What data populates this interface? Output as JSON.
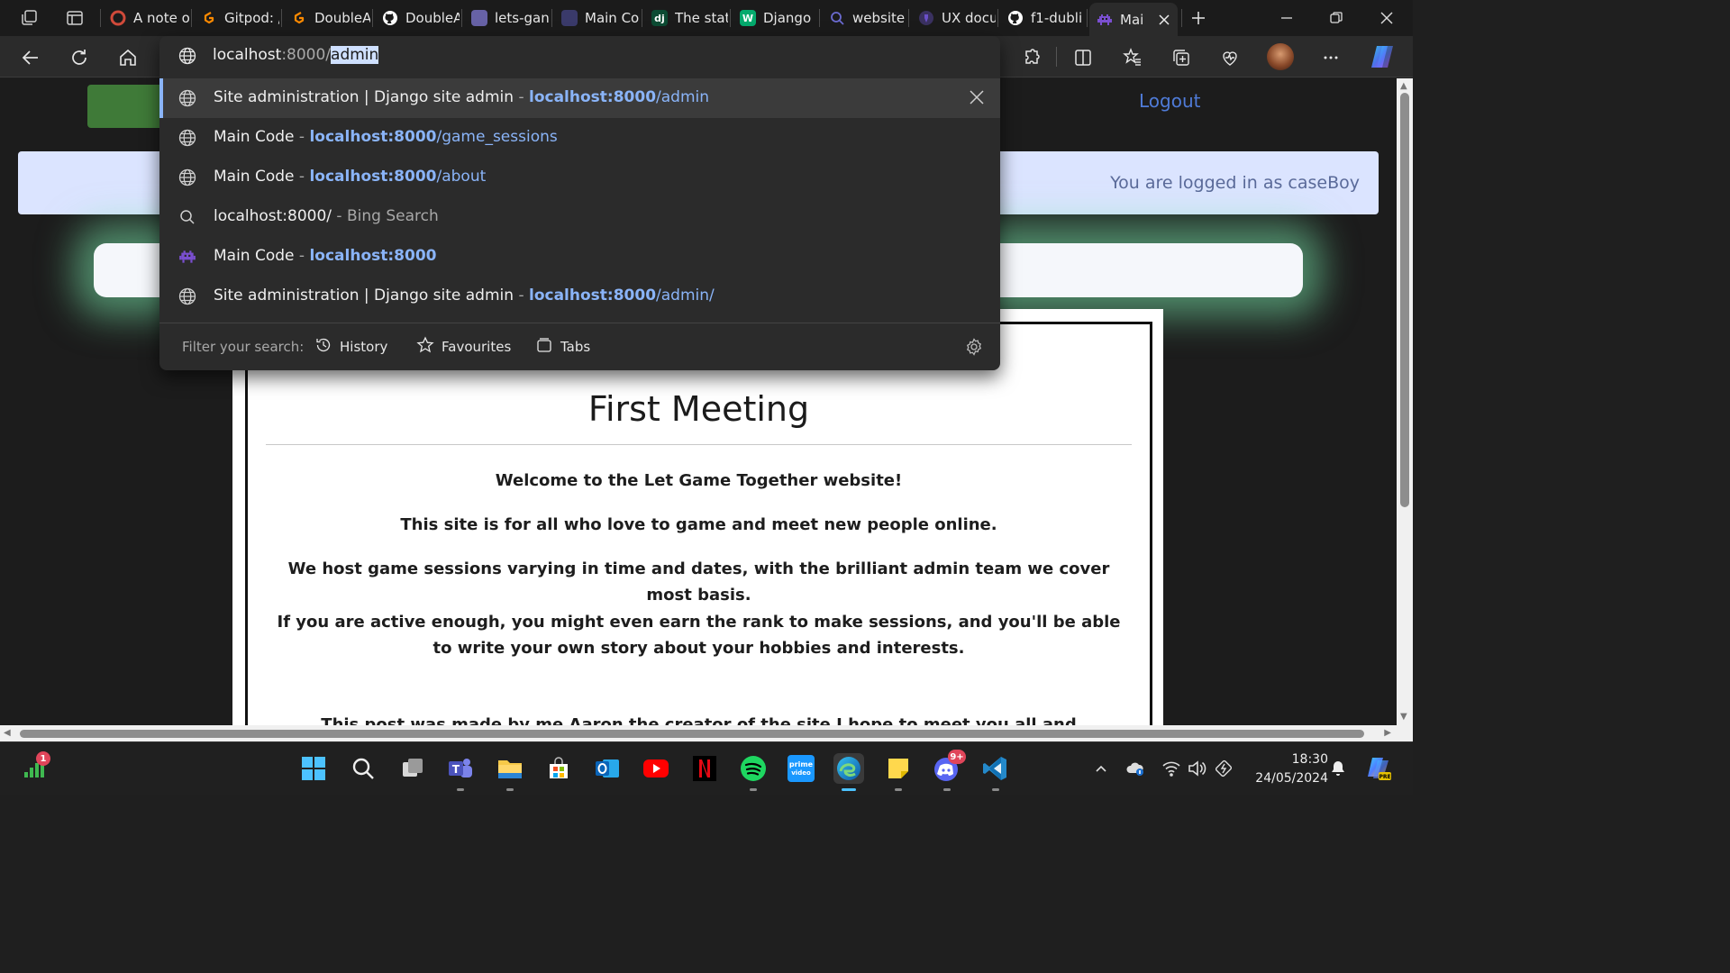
{
  "tabs": [
    {
      "title": "A note o",
      "favicon": "opera-icon",
      "color": "#d04a3a"
    },
    {
      "title": "Gitpod: /",
      "favicon": "gitpod-icon",
      "color": "#ff8a00"
    },
    {
      "title": "DoubleA",
      "favicon": "gitpod-icon",
      "color": "#ff8a00"
    },
    {
      "title": "DoubleA",
      "favicon": "github-icon",
      "color": "#ffffff"
    },
    {
      "title": "lets-gan",
      "favicon": "heroku-icon",
      "color": "#6762a6"
    },
    {
      "title": "Main Co",
      "favicon": "page-icon",
      "color": "#3a3a6a"
    },
    {
      "title": "The stat",
      "favicon": "django-icon",
      "letter": "dj",
      "color": "#0c4b33"
    },
    {
      "title": "Django",
      "favicon": "w3-icon",
      "letter": "W",
      "color": "#04aa6d"
    },
    {
      "title": "website",
      "favicon": "search-icon",
      "color": "#3c3c7a"
    },
    {
      "title": "UX docu",
      "favicon": "figma-icon",
      "color": "#6a4fc9"
    },
    {
      "title": "f1-dubli",
      "favicon": "github-icon",
      "color": "#ffffff"
    },
    {
      "title": "Mai",
      "favicon": "space-invader-icon",
      "color": "#7a4fd0"
    }
  ],
  "omnibox": {
    "typed": "localhost",
    "typed_dim": ":8000/",
    "typed_selected": "admin"
  },
  "suggestions": [
    {
      "icon": "globe-icon",
      "title": "Site administration | Django site admin",
      "sep": " - ",
      "host": "localhost:8000",
      "path": "/admin",
      "highlighted": true
    },
    {
      "icon": "globe-icon",
      "title": "Main Code",
      "sep": " - ",
      "host": "localhost:8000",
      "path": "/game_sessions"
    },
    {
      "icon": "globe-icon",
      "title": "Main Code",
      "sep": " - ",
      "host": "localhost:8000",
      "path": "/about"
    },
    {
      "icon": "search-icon",
      "title": "localhost:8000/",
      "sep": " - ",
      "gray": "Bing Search"
    },
    {
      "icon": "space-invader-icon",
      "title": "Main Code",
      "sep": " - ",
      "host": "localhost:8000",
      "path": ""
    },
    {
      "icon": "globe-icon",
      "title": "Site administration | Django site admin",
      "sep": " - ",
      "host": "localhost:8000",
      "path": "/admin/"
    }
  ],
  "filter": {
    "label": "Filter your search:",
    "history": "History",
    "favourites": "Favourites",
    "tabs": "Tabs"
  },
  "page": {
    "logout": "Logout",
    "logged_in": "You are logged in as caseBoy",
    "post_title": "First Meeting",
    "lines": [
      "Welcome to the Let Game Together website!",
      "This site is for all who love to game and meet new people online.",
      "We host game sessions varying in time and dates, with the brilliant admin team we cover most basis.",
      "If you are active enough, you might even earn the rank to make sessions, and you'll be able to write your own story about your hobbies and interests.",
      "This post was made by me Aaron the creator of the site I hope to meet you all and"
    ]
  },
  "taskbar": {
    "time": "18:30",
    "date": "24/05/2024",
    "network_badge": "1",
    "discord_badge": "9+"
  }
}
